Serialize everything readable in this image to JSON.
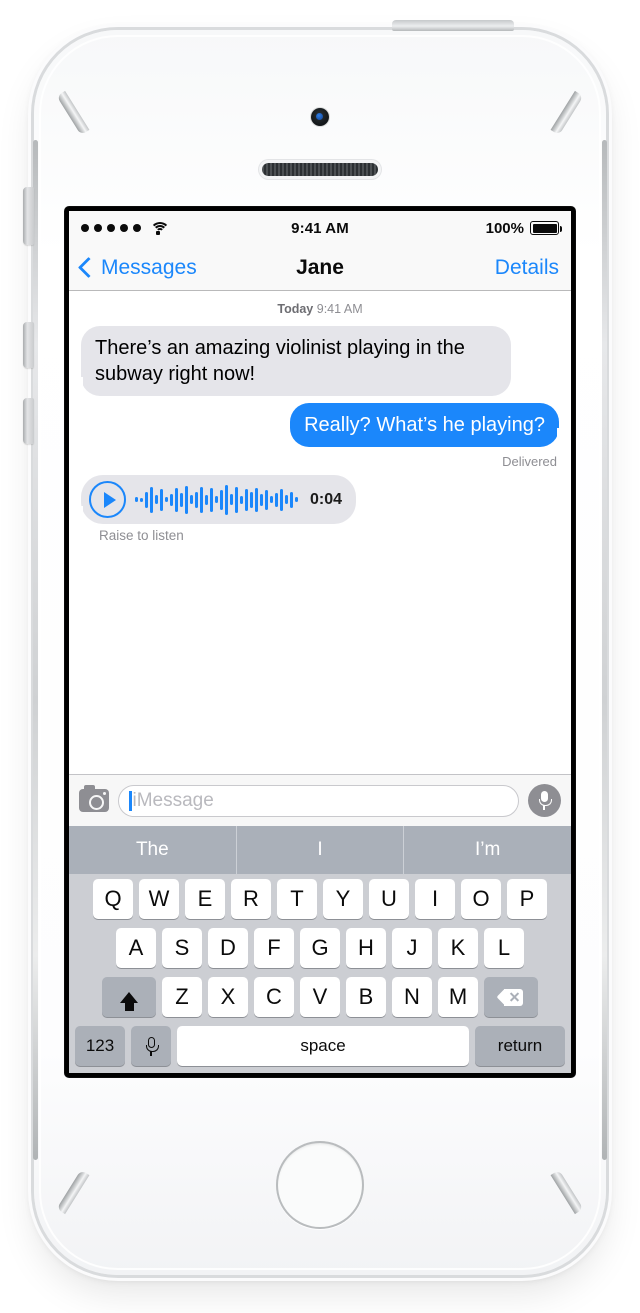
{
  "status_bar": {
    "signal_dots": 5,
    "wifi_icon": "wifi-icon",
    "time": "9:41 AM",
    "battery_percent": "100%",
    "battery_level": 100
  },
  "nav_bar": {
    "back_label": "Messages",
    "back_icon": "chevron-left-icon",
    "title": "Jane",
    "details_label": "Details"
  },
  "conversation": {
    "day_label": "Today",
    "day_time": "9:41 AM",
    "messages": [
      {
        "direction": "incoming",
        "text": "There’s an amazing violinist playing in the subway right now!"
      },
      {
        "direction": "outgoing",
        "text": "Really? What’s he playing?",
        "receipt": "Delivered"
      }
    ],
    "audio_message": {
      "play_icon": "play-icon",
      "duration": "0:04",
      "hint": "Raise to listen",
      "waveform": [
        5,
        4,
        16,
        26,
        9,
        22,
        5,
        12,
        24,
        14,
        28,
        9,
        16,
        26,
        10,
        24,
        7,
        20,
        30,
        11,
        26,
        8,
        22,
        16,
        24,
        12,
        20,
        7,
        14,
        22,
        9,
        16,
        5
      ]
    }
  },
  "input_bar": {
    "camera_icon": "camera-icon",
    "placeholder": "iMessage",
    "value": "",
    "mic_icon": "microphone-icon"
  },
  "predictive_bar": {
    "suggestions": [
      "The",
      "I",
      "I’m"
    ]
  },
  "keyboard": {
    "row1": [
      "Q",
      "W",
      "E",
      "R",
      "T",
      "Y",
      "U",
      "I",
      "O",
      "P"
    ],
    "row2": [
      "A",
      "S",
      "D",
      "F",
      "G",
      "H",
      "J",
      "K",
      "L"
    ],
    "row3": [
      "Z",
      "X",
      "C",
      "V",
      "B",
      "N",
      "M"
    ],
    "shift_icon": "shift-icon",
    "delete_icon": "delete-icon",
    "numbers_label": "123",
    "dictation_icon": "microphone-icon",
    "space_label": "space",
    "return_label": "return"
  },
  "colors": {
    "imessage_blue": "#1b87fb",
    "incoming_gray": "#e5e5ea",
    "keyboard_bg": "#ccced3",
    "predictive_bg": "#aab0b9"
  }
}
